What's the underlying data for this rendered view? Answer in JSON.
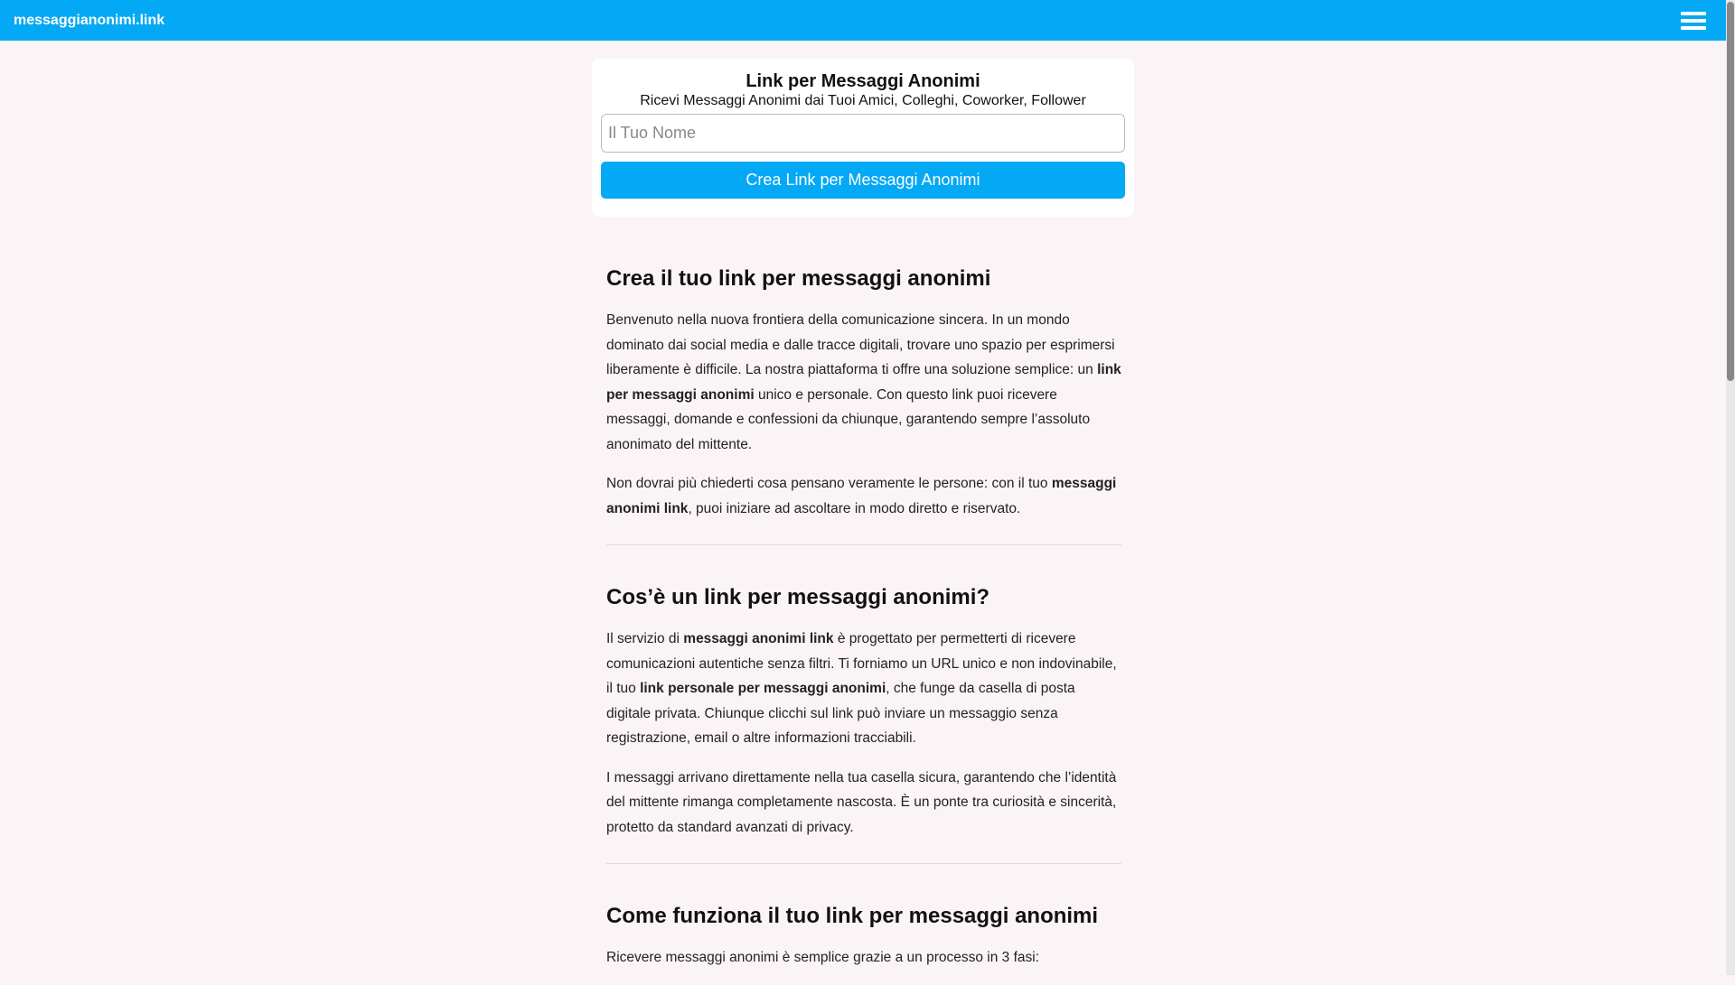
{
  "header": {
    "brand": "messaggianonimi.link",
    "menu_icon": "hamburger-menu-icon"
  },
  "card": {
    "title": "Link per Messaggi Anonimi",
    "subtitle": "Ricevi Messaggi Anonimi dai Tuoi Amici, Colleghi, Coworker, Follower",
    "input_placeholder": "Il Tuo Nome",
    "input_value": "",
    "button_label": "Crea Link per Messaggi Anonimi"
  },
  "sections": [
    {
      "heading": "Crea il tuo link per messaggi anonimi",
      "p1": {
        "a": "Benvenuto nella nuova frontiera della comunicazione sincera. In un mondo dominato dai social media e dalle tracce digitali, trovare uno spazio per esprimersi liberamente è difficile. La nostra piattaforma ti offre una soluzione semplice: un ",
        "b": "link per messaggi anonimi",
        "c": " unico e personale. Con questo link puoi ricevere messaggi, domande e confessioni da chiunque, garantendo sempre l’assoluto anonimato del mittente."
      },
      "p2": {
        "a": "Non dovrai più chiederti cosa pensano veramente le persone: con il tuo ",
        "b": "messaggi anonimi link",
        "c": ", puoi iniziare ad ascoltare in modo diretto e riservato."
      }
    },
    {
      "heading": "Cos’è un link per messaggi anonimi?",
      "p1": {
        "a": "Il servizio di ",
        "b": "messaggi anonimi link",
        "c": " è progettato per permetterti di ricevere comunicazioni autentiche senza filtri. Ti forniamo un URL unico e non indovinabile, il tuo ",
        "d": "link personale per messaggi anonimi",
        "e": ", che funge da casella di posta digitale privata. Chiunque clicchi sul link può inviare un messaggio senza registrazione, email o altre informazioni tracciabili."
      },
      "p2": "I messaggi arrivano direttamente nella tua casella sicura, garantendo che l’identità del mittente rimanga completamente nascosta. È un ponte tra curiosità e sincerità, protetto da standard avanzati di privacy."
    },
    {
      "heading": "Come funziona il tuo link per messaggi anonimi",
      "p1": "Ricevere messaggi anonimi è semplice grazie a un processo in 3 fasi:"
    }
  ]
}
